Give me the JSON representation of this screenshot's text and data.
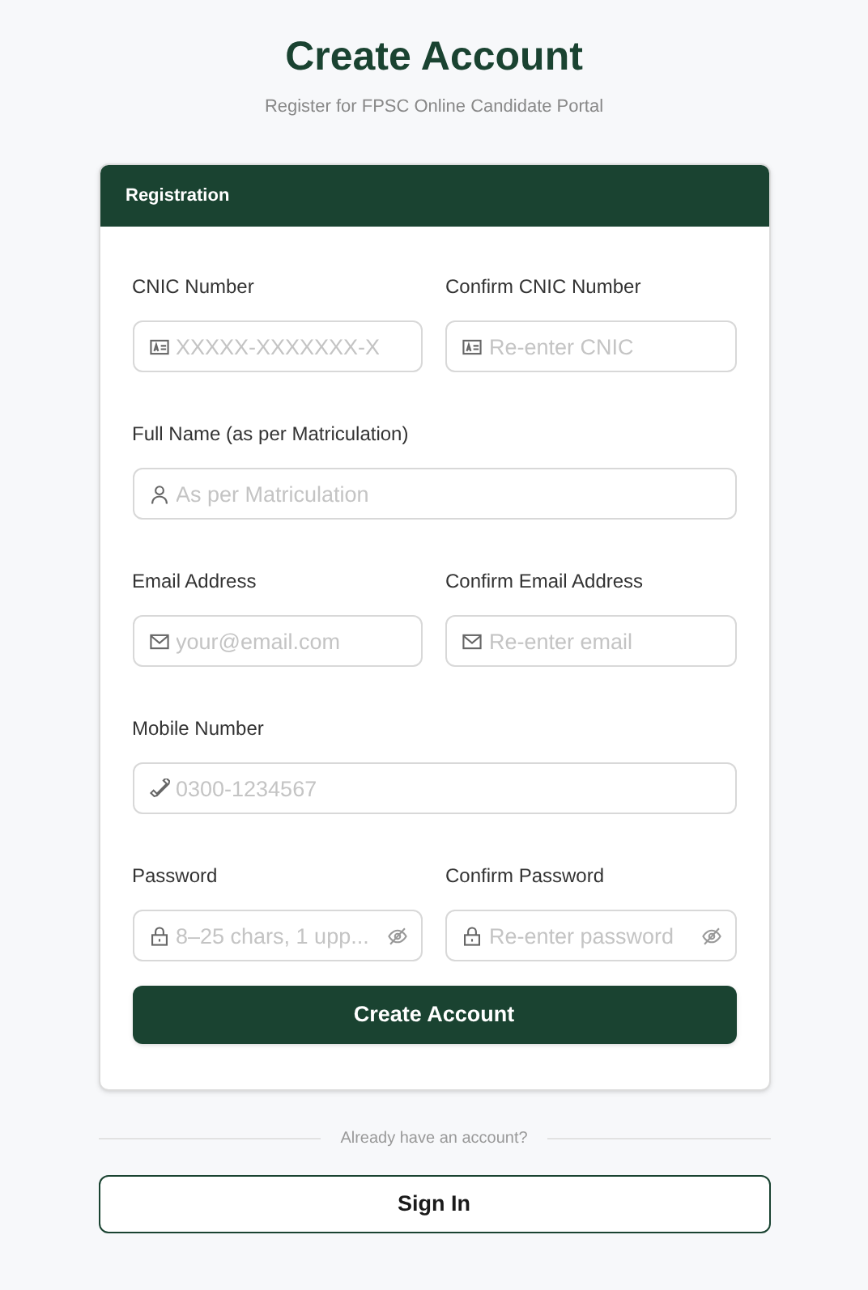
{
  "title": "Create Account",
  "subtitle": "Register for FPSC Online Candidate Portal",
  "card": {
    "header": "Registration",
    "rows": [
      [
        {
          "label": "CNIC Number",
          "placeholder": "XXXXX-XXXXXXX-X",
          "kind": "cnic"
        },
        {
          "label": "Confirm CNIC Number",
          "placeholder": "Re-enter CNIC",
          "kind": "cnic"
        }
      ],
      [
        {
          "label": "Full Name (as per Matriculation)",
          "placeholder": "As per Matriculation",
          "kind": "name"
        }
      ],
      [
        {
          "label": "Email Address",
          "placeholder": "your@email.com",
          "kind": "email"
        },
        {
          "label": "Confirm Email Address",
          "placeholder": "Re-enter email",
          "kind": "email"
        }
      ],
      [
        {
          "label": "Mobile Number",
          "placeholder": "0300-1234567",
          "kind": "phone"
        }
      ],
      [
        {
          "label": "Password",
          "placeholder": "8–25 chars, 1 upp...",
          "kind": "password"
        },
        {
          "label": "Confirm Password",
          "placeholder": "Re-enter password",
          "kind": "password"
        }
      ]
    ],
    "submit": "Create Account"
  },
  "divider_text": "Already have an account?",
  "sign_in": "Sign In"
}
